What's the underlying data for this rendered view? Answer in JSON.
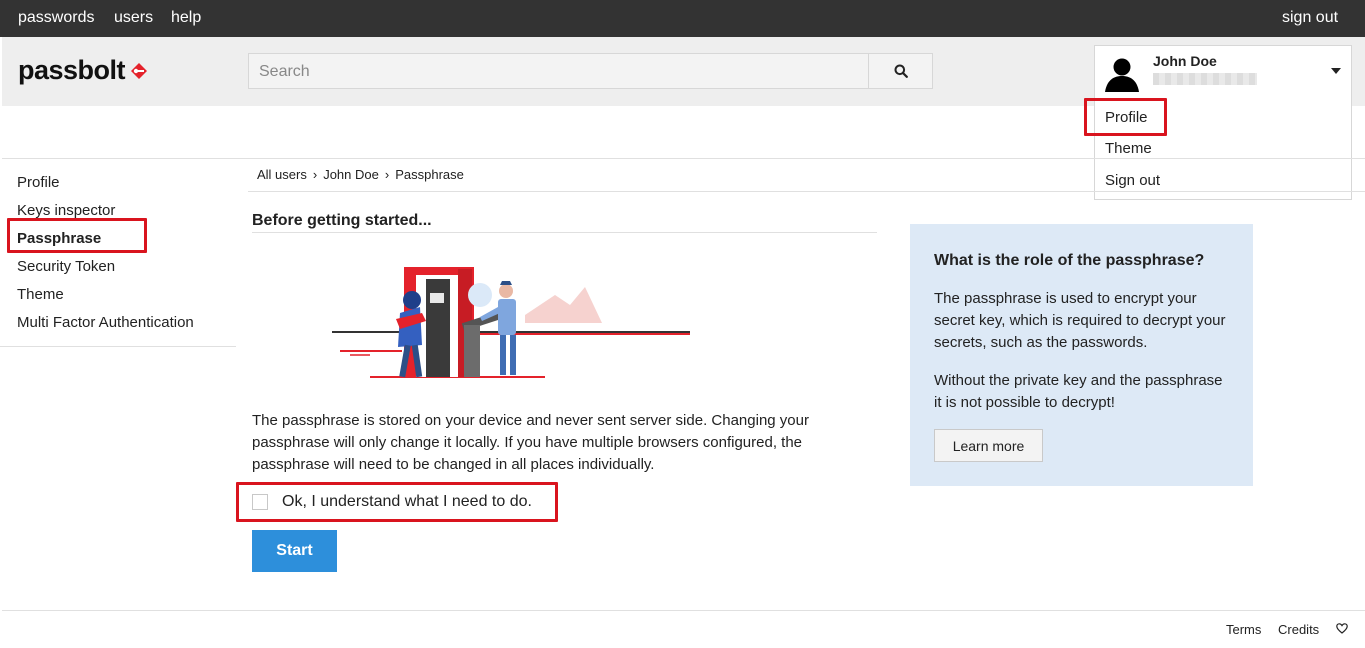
{
  "topnav": {
    "passwords": "passwords",
    "users": "users",
    "help": "help",
    "sign_out": "sign out"
  },
  "header": {
    "logo_text": "passbolt",
    "search_placeholder": "Search",
    "user_name": "John Doe"
  },
  "user_menu": {
    "profile": "Profile",
    "theme": "Theme",
    "sign_out": "Sign out"
  },
  "sidebar": {
    "items": [
      {
        "label": "Profile",
        "active": false
      },
      {
        "label": "Keys inspector",
        "active": false
      },
      {
        "label": "Passphrase",
        "active": true
      },
      {
        "label": "Security Token",
        "active": false
      },
      {
        "label": "Theme",
        "active": false
      },
      {
        "label": "Multi Factor Authentication",
        "active": false
      }
    ]
  },
  "breadcrumb": [
    "All users",
    "John Doe",
    "Passphrase"
  ],
  "main": {
    "title": "Before getting started...",
    "description": "The passphrase is stored on your device and never sent server side. Changing your passphrase will only change it locally. If you have multiple browsers configured, the passphrase will need to be changed in all places individually.",
    "checkbox_label": "Ok, I understand what I need to do.",
    "checkbox_checked": false,
    "start_button": "Start"
  },
  "help": {
    "title": "What is the role of the passphrase?",
    "paragraph1": "The passphrase is used to encrypt your secret key, which is required to decrypt your secrets, such as the passwords.",
    "paragraph2": "Without the private key and the passphrase it is not possible to decrypt!",
    "learn_more": "Learn more"
  },
  "footer": {
    "terms": "Terms",
    "credits": "Credits"
  },
  "colors": {
    "accent": "#2d8fdb",
    "highlight": "#d9141e",
    "topbar": "#333333",
    "help_bg": "#dde9f6",
    "brand_red": "#e4222b"
  }
}
